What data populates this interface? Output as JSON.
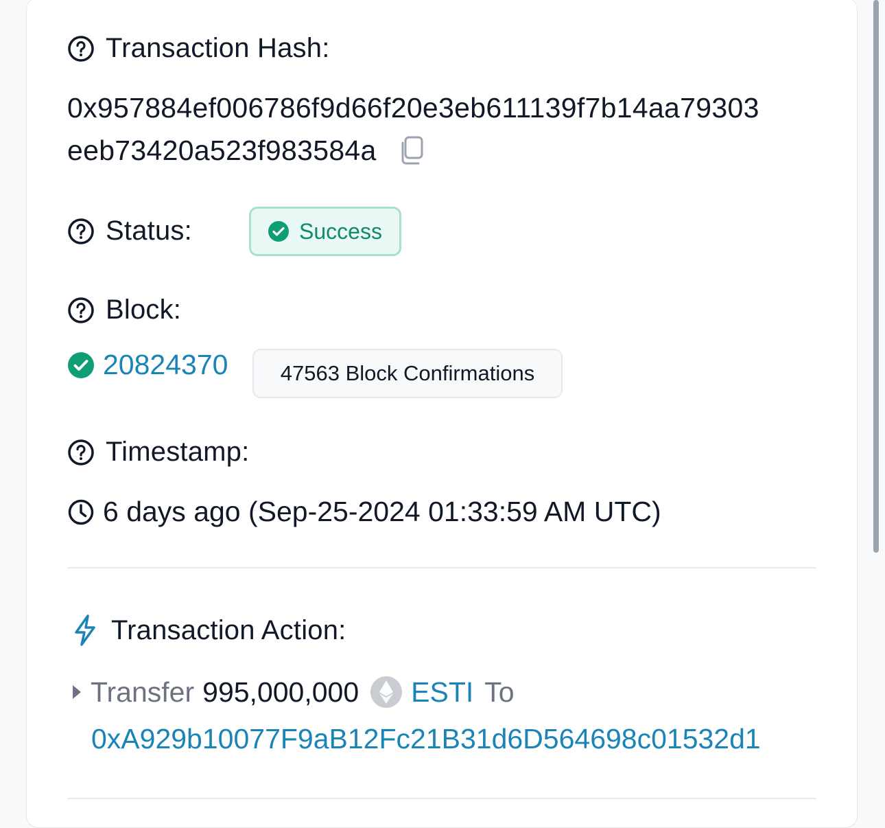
{
  "hash_section": {
    "label": "Transaction Hash:",
    "line1": "0x957884ef006786f9d66f20e3eb611139f7b14aa79303",
    "line2": "eeb73420a523f983584a",
    "copy_icon": "copy-icon"
  },
  "status_section": {
    "label": "Status:",
    "badge": "Success"
  },
  "block_section": {
    "label": "Block:",
    "number": "20824370",
    "confirmations": "47563 Block Confirmations"
  },
  "timestamp_section": {
    "label": "Timestamp:",
    "value": "6 days ago (Sep-25-2024 01:33:59 AM UTC)"
  },
  "action_section": {
    "label": "Transaction Action:",
    "verb": "Transfer",
    "amount": "995,000,000",
    "token": "ESTI",
    "preposition": "To",
    "recipient": "0xA929b10077F9aB12Fc21B31d6D564698c01532d1"
  },
  "colors": {
    "link": "#1a84b6",
    "success_green": "#0f9d76",
    "success_badge_bg": "#e9f8f4",
    "text": "#111827"
  }
}
